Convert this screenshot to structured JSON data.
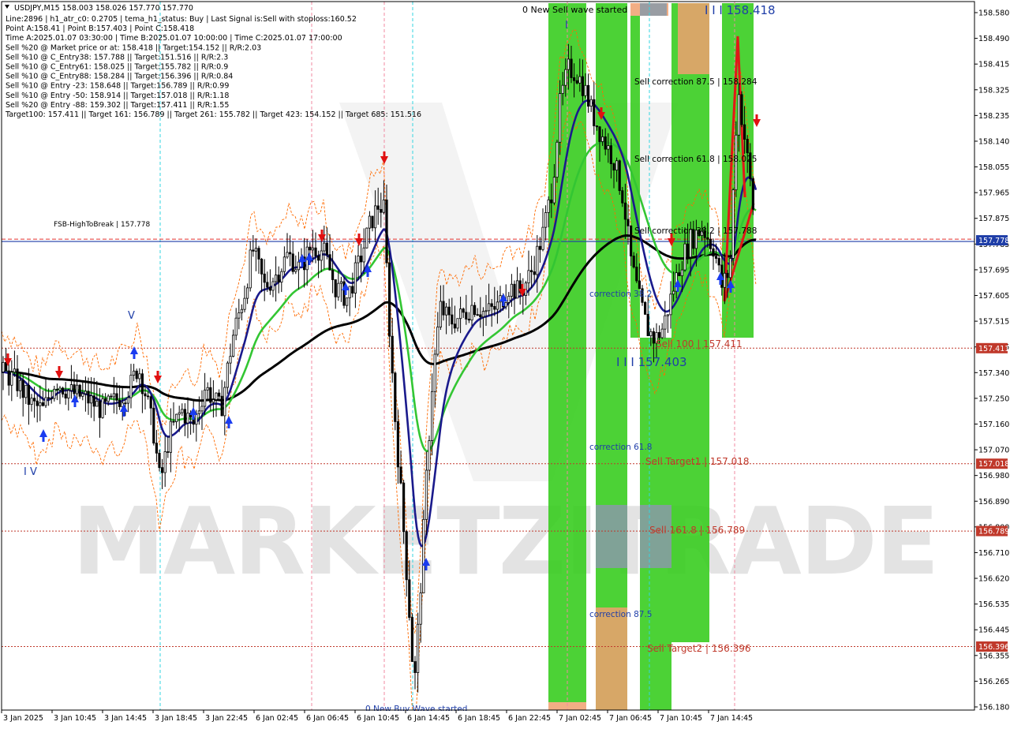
{
  "chart_data": {
    "type": "candlestick",
    "symbol_header": "USDJPY,M15  158.003 158.026 157.770 157.770",
    "info_lines": [
      "Line:2896 | h1_atr_c0: 0.2705 | tema_h1_status: Buy | Last Signal is:Sell with stoploss:160.52",
      "Point A:158.41 | Point B:157.403 | Point C:158.418",
      "Time A:2025.01.07 03:30:00 | Time B:2025.01.07 10:00:00 | Time C:2025.01.07 17:00:00",
      "Sell %20 @ Market price or at: 158.418 || Target:154.152 || R/R:2.03",
      "Sell %10 @ C_Entry38: 157.788 || Target:151.516 || R/R:2.3",
      "Sell %10 @ C_Entry61: 158.025 || Target:155.782 || R/R:0.9",
      "Sell %10 @ C_Entry88: 158.284 || Target:156.396 || R/R:0.84",
      "Sell %10 @ Entry -23: 158.648 || Target:156.789 || R/R:0.99",
      "Sell %10 @ Entry -50: 158.914 || Target:157.018 || R/R:1.18",
      "Sell %20 @ Entry -88: 159.302 || Target:157.411 || R/R:1.55",
      "Target100: 157.411 || Target 161: 156.789 || Target 261: 155.782 || Target 423: 154.152 || Target 685: 151.516"
    ],
    "y_ticks": [
      "158.580",
      "158.490",
      "158.415",
      "158.325",
      "158.235",
      "158.140",
      "158.055",
      "157.965",
      "157.875",
      "157.785",
      "157.695",
      "157.605",
      "157.515",
      "157.425",
      "157.340",
      "157.250",
      "157.160",
      "157.070",
      "156.980",
      "156.890",
      "156.800",
      "156.710",
      "156.620",
      "156.535",
      "156.445",
      "156.355",
      "156.265",
      "156.180"
    ],
    "x_ticks": [
      "3 Jan 2025",
      "3 Jan 10:45",
      "3 Jan 14:45",
      "3 Jan 18:45",
      "3 Jan 22:45",
      "6 Jan 02:45",
      "6 Jan 06:45",
      "6 Jan 10:45",
      "6 Jan 14:45",
      "6 Jan 18:45",
      "6 Jan 22:45",
      "7 Jan 02:45",
      "7 Jan 06:45",
      "7 Jan 10:45",
      "7 Jan 14:45"
    ],
    "y_range": [
      156.18,
      158.59
    ],
    "horizontal_levels": [
      {
        "price": 157.778,
        "tag": "157.778",
        "color": "#1f3ea8",
        "label": "FSB-HighToBreak | 157.778"
      },
      {
        "price": 157.411,
        "tag": "157.411",
        "color": "#c0392b",
        "label": "Sell 100 | 157.411"
      },
      {
        "price": 157.018,
        "tag": "157.018",
        "color": "#c0392b",
        "label": "Sell Target1 | 157.018"
      },
      {
        "price": 156.789,
        "tag": "156.789",
        "color": "#c0392b",
        "label": "Sell 161.8 | 156.789"
      },
      {
        "price": 156.396,
        "tag": "156.396",
        "color": "#c0392b",
        "label": "Sell Target2 | 156.396"
      }
    ],
    "annotations": [
      {
        "text": "0 New Sell wave started",
        "color": "#000000"
      },
      {
        "text": "I I I 158.418",
        "color": "#1f3ea8"
      },
      {
        "text": "I",
        "color": "#1f3ea8"
      },
      {
        "text": "Sell correction 87.5 | 158.284",
        "color": "#000000"
      },
      {
        "text": "Sell correction 61.8 | 158.025",
        "color": "#000000"
      },
      {
        "text": "Sell correction 38.2 | 157.788",
        "color": "#000000"
      },
      {
        "text": "correction 38.2",
        "color": "#1f3ea8"
      },
      {
        "text": "I I I 157.403",
        "color": "#1f3ea8"
      },
      {
        "text": "correction 61.8",
        "color": "#1f3ea8"
      },
      {
        "text": "correction 87.5",
        "color": "#1f3ea8"
      },
      {
        "text": "I V",
        "color": "#1f3ea8"
      },
      {
        "text": "V",
        "color": "#1f3ea8"
      },
      {
        "text": "0 New Buy Wave started",
        "color": "#1f3ea8"
      }
    ],
    "colors": {
      "ema_dark": "#000000",
      "ema_green": "#33c633",
      "ema_navy": "#1a1a8c",
      "bands": "#ff6a00",
      "zone_green": "#33cc1a",
      "zone_orange": "#f0a070",
      "up_arrow": "#1a3cf0",
      "down_arrow": "#e01010",
      "price_tag": "#1f3ea8",
      "level_tag": "#c0392b"
    },
    "watermark": "MARKETZITRADE"
  }
}
